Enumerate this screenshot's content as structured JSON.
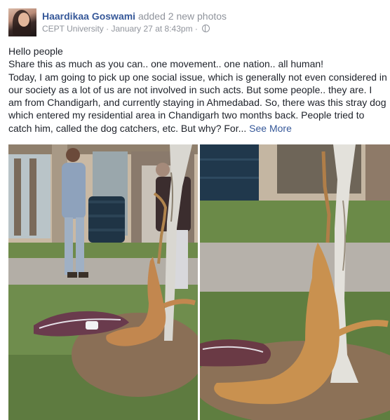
{
  "header": {
    "author": "Haardikaa Goswami",
    "action": "added 2 new photos",
    "location": "CEPT University",
    "separator": "·",
    "time": "January 27 at 8:43pm",
    "separator2": "·",
    "privacy_icon": "globe-icon"
  },
  "body": {
    "lines": [
      "Hello people",
      "Share this as much as you can.. one movement.. one nation.. all human!",
      "Today, I am going to pick up one social issue, which is generally not even considered in our society as a lot of us are not involved in such acts. But some people.. they are. I am from Chandigarh, and currently staying in Ahmedabad. So, there was this stray dog which entered my residential area in Chandigarh two months back. People tried to catch him, called the dog catchers, etc. But why? For..."
    ],
    "see_more": "See More"
  },
  "photos": [
    {
      "icon": "photo-dog-tied-to-tree-with-man-icon"
    },
    {
      "icon": "photo-dog-hanging-closeup-icon"
    }
  ],
  "colors": {
    "link": "#365899",
    "meta": "#90949c",
    "text": "#1d2129"
  }
}
